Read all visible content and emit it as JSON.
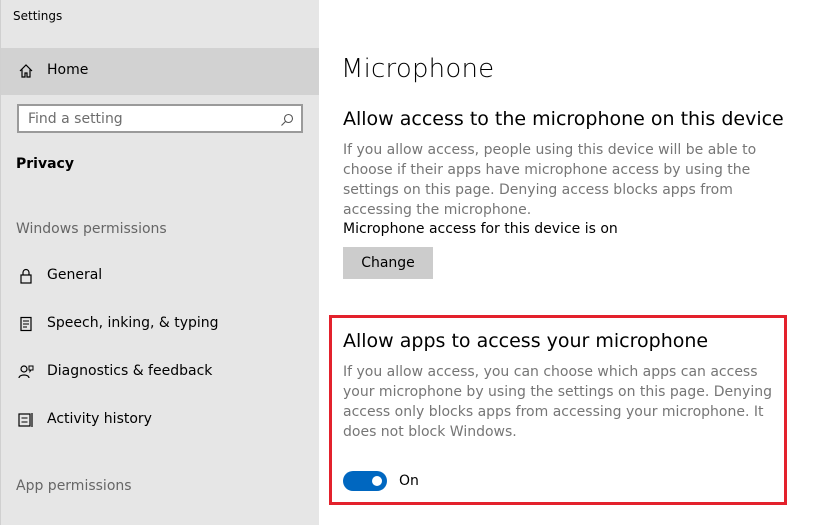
{
  "window": {
    "title": "Settings"
  },
  "sidebar": {
    "home_label": "Home",
    "search_placeholder": "Find a setting",
    "section": "Privacy",
    "groups": {
      "windows_permissions": "Windows permissions",
      "app_permissions": "App permissions"
    },
    "items": [
      {
        "label": "General",
        "icon": "lock-icon"
      },
      {
        "label": "Speech, inking, & typing",
        "icon": "document-icon"
      },
      {
        "label": "Diagnostics & feedback",
        "icon": "person-feedback-icon"
      },
      {
        "label": "Activity history",
        "icon": "activity-history-icon"
      }
    ]
  },
  "main": {
    "title": "Microphone",
    "device_access": {
      "heading": "Allow access to the microphone on this device",
      "description": "If you allow access, people using this device will be able to choose if their apps have microphone access by using the settings on this page. Denying access blocks apps from accessing the microphone.",
      "status": "Microphone access for this device is on",
      "button_label": "Change"
    },
    "app_access": {
      "heading": "Allow apps to access your microphone",
      "description": "If you allow access, you can choose which apps can access your microphone by using the settings on this page. Denying access only blocks apps from accessing your microphone. It does not block Windows.",
      "toggle_state": "On",
      "toggle_on": true
    }
  },
  "colors": {
    "accent": "#0067c0",
    "highlight_border": "#e3212c",
    "sidebar_bg": "#e6e6e6"
  }
}
